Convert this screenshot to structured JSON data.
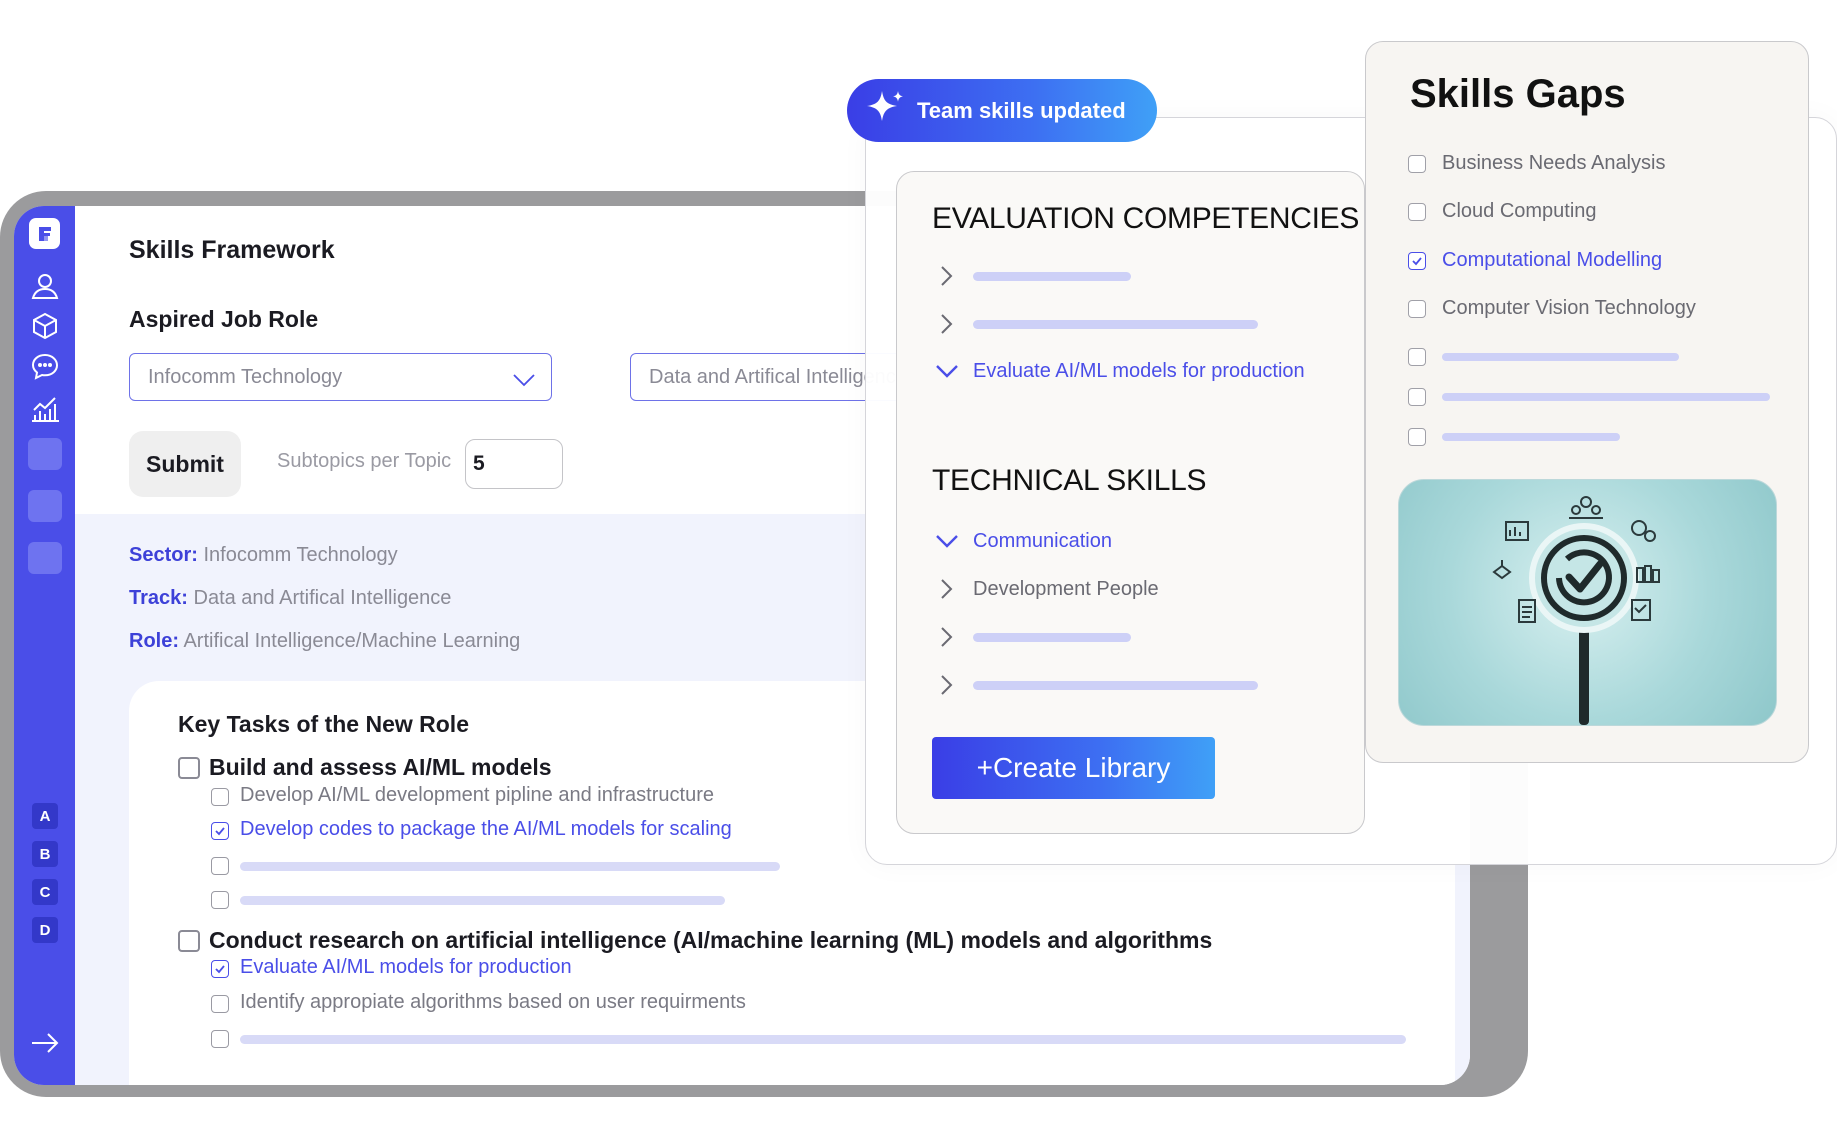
{
  "app": {
    "title": "Skills Framework",
    "sidebar": {
      "icons": [
        "logo-icon",
        "user-icon",
        "cube-icon",
        "chat-icon",
        "chart-icon"
      ],
      "letters": [
        "A",
        "B",
        "C",
        "D"
      ],
      "accent": "#4a4ee8"
    },
    "form": {
      "aspired_label": "Aspired Job Role",
      "sector_select": "Infocomm Technology",
      "track_select": "Data and Artifical Intelligence",
      "submit_label": "Submit",
      "subtopics_label": "Subtopics per Topic",
      "subtopics_value": "5"
    },
    "info": {
      "sector_key": "Sector:",
      "sector_value": "Infocomm Technology",
      "track_key": "Track:",
      "track_value": "Data and Artifical Intelligence",
      "role_key": "Role:",
      "role_value": "Artifical Intelligence/Machine Learning"
    },
    "tasks": {
      "title": "Key Tasks of the New Role",
      "items": [
        {
          "label": "Build and assess AI/ML models",
          "checked": false,
          "subs": [
            {
              "label": "Develop AI/ML development pipline and infrastructure",
              "checked": false
            },
            {
              "label": "Develop codes to package the AI/ML models for scaling",
              "checked": true
            }
          ]
        },
        {
          "label": "Conduct research on artificial intelligence (AI/machine learning (ML) models and algorithms",
          "checked": false,
          "subs": [
            {
              "label": "Evaluate AI/ML models for production",
              "checked": true
            },
            {
              "label": "Identify appropiate algorithms based on user requirments",
              "checked": false
            }
          ]
        }
      ]
    }
  },
  "notification": {
    "label": "Team skills updated",
    "icon": "sparkle-icon"
  },
  "evaluation": {
    "competencies_title": "EVALUATION COMPETENCIES",
    "competency_expanded": "Evaluate AI/ML models for production",
    "technical_title": "TECHNICAL SKILLS",
    "technical_items": [
      "Communication",
      "Development People"
    ],
    "create_button": "+Create Library"
  },
  "skills_gaps": {
    "title": "Skills Gaps",
    "items": [
      {
        "label": "Business Needs Analysis",
        "checked": false
      },
      {
        "label": "Cloud Computing",
        "checked": false
      },
      {
        "label": "Computational Modelling",
        "checked": true
      },
      {
        "label": "Computer Vision Technology",
        "checked": false
      }
    ],
    "image_icon": "magnifier-check-icon"
  }
}
